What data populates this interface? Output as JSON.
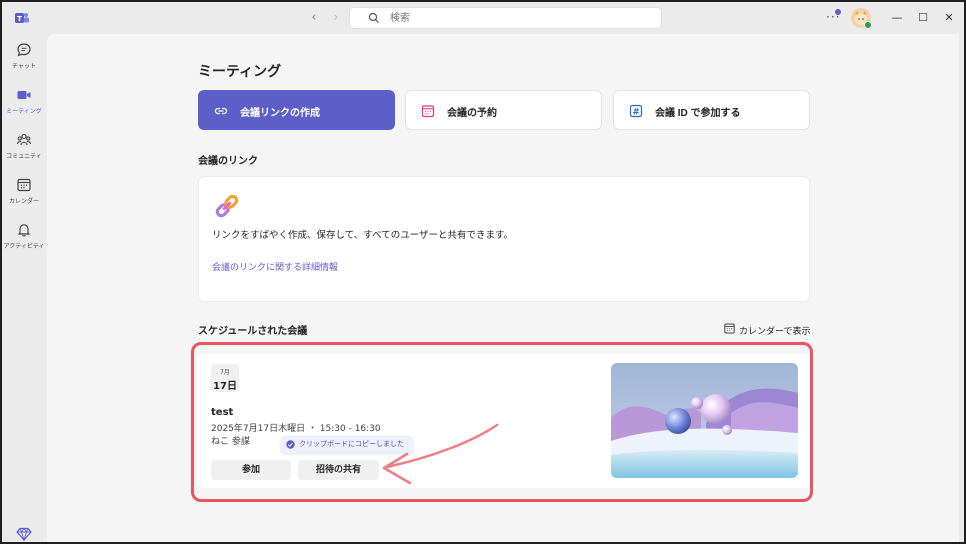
{
  "search": {
    "placeholder": "検索"
  },
  "rail": {
    "items": [
      {
        "label": "チャット"
      },
      {
        "label": "ミーティング"
      },
      {
        "label": "コミュニティ"
      },
      {
        "label": "カレンダー"
      },
      {
        "label": "アクティビティ"
      }
    ]
  },
  "main": {
    "title": "ミーティング",
    "actions": [
      {
        "label": "会議リンクの作成",
        "icon": "link-icon"
      },
      {
        "label": "会議の予約",
        "icon": "calendar-icon"
      },
      {
        "label": "会議 ID で参加する",
        "icon": "hash-icon"
      }
    ],
    "link_section": {
      "title": "会議のリンク",
      "description": "リンクをすばやく作成、保存して、すべてのユーザーと共有できます。",
      "learn_more": "会議のリンクに関する詳細情報"
    },
    "scheduled": {
      "title": "スケジュールされた会議",
      "calendar_view": "カレンダーで表示",
      "meeting": {
        "month": "7月",
        "day": "17日",
        "title": "test",
        "time": "2025年7月17日木曜日 ・ 15:30 - 16:30",
        "organizer": "ねこ 参謀",
        "toast": "クリップボードにコピーしました",
        "join_label": "参加",
        "share_label": "招待の共有"
      }
    }
  },
  "colors": {
    "accent": "#5b5fc7",
    "highlight": "#e8555f"
  }
}
